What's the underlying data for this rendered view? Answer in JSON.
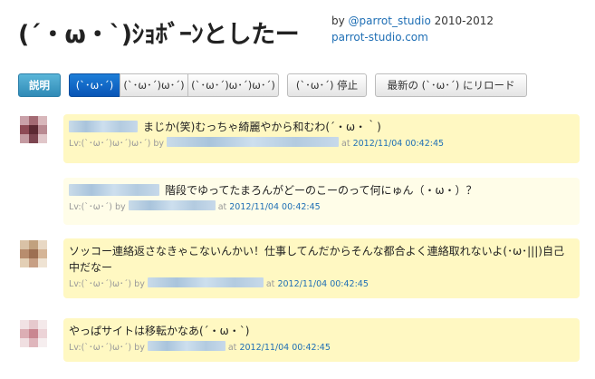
{
  "header": {
    "title": "(´・ω・`)ｼｮﾎﾞｰﾝとしたー",
    "credit_prefix": "by ",
    "credit_handle": "@parrot_studio",
    "credit_years": " 2010-2012",
    "credit_site": "parrot-studio.com"
  },
  "toolbar": {
    "info_label": "説明",
    "levels": [
      "(`･ω･´)",
      "(`･ω･´)ω･´)",
      "(`･ω･´)ω･´)ω･´)"
    ],
    "stop_label": "(`･ω･´) 停止",
    "reload_label": "最新の (`･ω･´) にリロード"
  },
  "colors": {
    "bubble": "#fff8c2",
    "bubble_light": "#fffde8",
    "primary": "#0955b6",
    "info": "#2f8ab6",
    "link": "#1f6fb5"
  },
  "posts": [
    {
      "text": "まじか(笑)むっちゃ綺麗やから和むわ(´・ω・｀)",
      "level": "Lv:(`･ω･´)ω･´)ω･´)",
      "by": " by ",
      "at": " at ",
      "timestamp": "2012/11/04 00:42:45"
    },
    {
      "text": "階段でゆってたまろんがどーのこーのって何にゅん（・ω・）？",
      "level": "Lv:(`･ω･´)",
      "by": " by ",
      "at": " at ",
      "timestamp": "2012/11/04 00:42:45"
    },
    {
      "text": "ソッコー連絡返さなきゃこないんかい！仕事してんだからそんな都合よく連絡取れないよ(･ω･|||)自己中だなー",
      "level": "Lv:(`･ω･´)ω･´)",
      "by": " by ",
      "at": " at ",
      "timestamp": "2012/11/04 00:42:45"
    },
    {
      "text": "やっぱサイトは移転かなあ(´・ω・`)",
      "level": "Lv:(`･ω･´)ω･´)",
      "by": " by ",
      "at": " at ",
      "timestamp": "2012/11/04 00:42:45"
    }
  ]
}
